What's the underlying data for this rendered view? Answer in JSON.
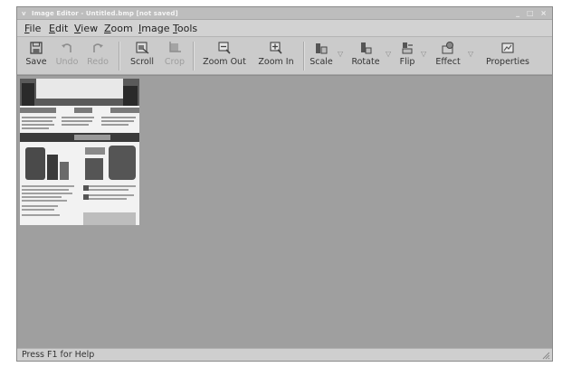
{
  "window": {
    "title": "Image Editor - Untitled.bmp [not saved]",
    "controls": [
      "_",
      "□",
      "×"
    ],
    "menu_icon": "v"
  },
  "menu": [
    {
      "label": "File"
    },
    {
      "label": "Edit"
    },
    {
      "label": "View"
    },
    {
      "label": "Zoom"
    },
    {
      "label": "Image"
    },
    {
      "label": "Tools"
    }
  ],
  "toolbar": {
    "save": {
      "label": "Save",
      "icon": "floppy-icon"
    },
    "undo": {
      "label": "Undo",
      "icon": "undo-icon",
      "enabled": false
    },
    "redo": {
      "label": "Redo",
      "icon": "redo-icon",
      "enabled": false
    },
    "scroll": {
      "label": "Scroll",
      "icon": "scroll-icon"
    },
    "crop": {
      "label": "Crop",
      "icon": "crop-icon",
      "enabled": false
    },
    "zoom_out": {
      "label": "Zoom Out",
      "icon": "zoom-out-icon"
    },
    "zoom_in": {
      "label": "Zoom In",
      "icon": "zoom-in-icon"
    },
    "scale": {
      "label": "Scale",
      "icon": "scale-icon"
    },
    "rotate": {
      "label": "Rotate",
      "icon": "rotate-icon"
    },
    "flip": {
      "label": "Flip",
      "icon": "flip-icon"
    },
    "effect": {
      "label": "Effect",
      "icon": "effect-icon"
    },
    "properties": {
      "label": "Properties",
      "icon": "properties-icon"
    },
    "dropdown_glyph": "▽"
  },
  "canvas": {
    "background": "#9f9f9f",
    "image": "scanned document thumbnail"
  },
  "status": {
    "text": "Press F1 for Help"
  }
}
